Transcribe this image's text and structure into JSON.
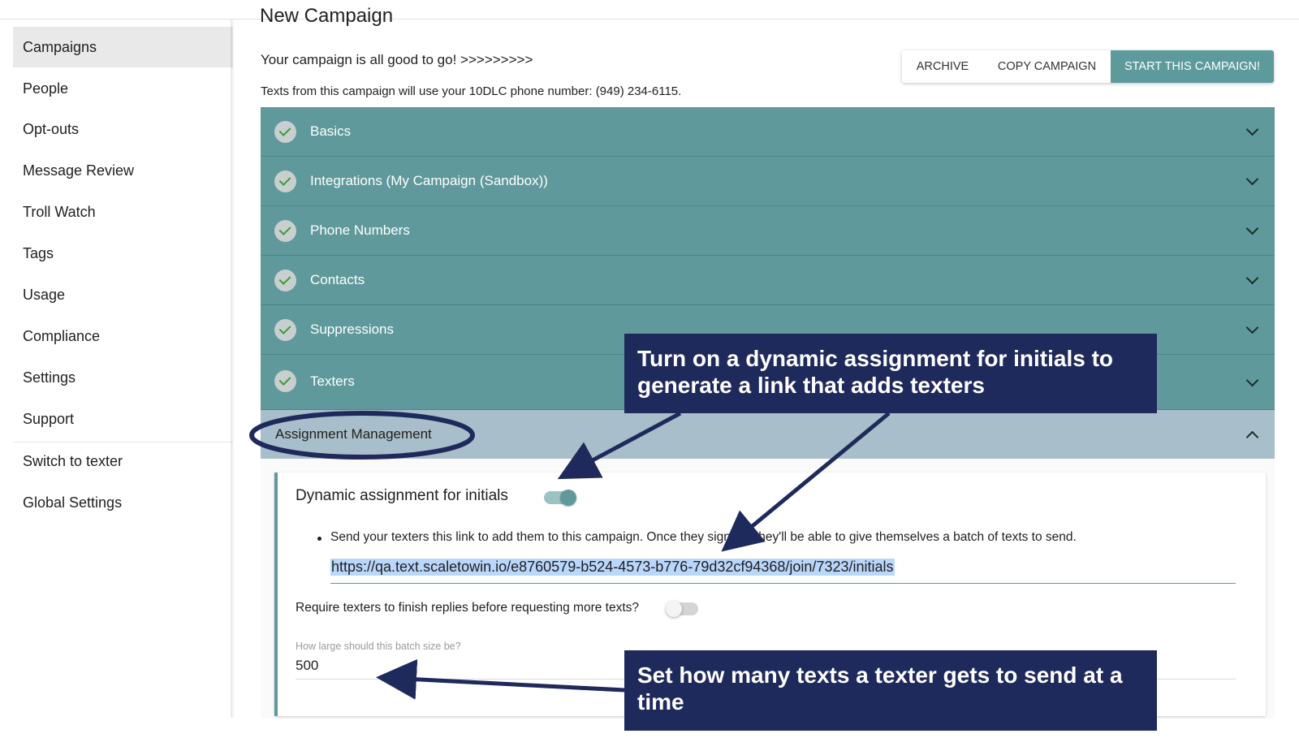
{
  "sidebar": {
    "items": [
      {
        "label": "Campaigns",
        "active": true
      },
      {
        "label": "People"
      },
      {
        "label": "Opt-outs"
      },
      {
        "label": "Message Review"
      },
      {
        "label": "Troll Watch"
      },
      {
        "label": "Tags"
      },
      {
        "label": "Usage"
      },
      {
        "label": "Compliance"
      },
      {
        "label": "Settings"
      },
      {
        "label": "Support"
      },
      {
        "label": "Switch to texter"
      },
      {
        "label": "Global Settings"
      }
    ]
  },
  "header": {
    "title": "New Campaign",
    "status": "Your campaign is all good to go! >>>>>>>>>",
    "phone_notice": "Texts from this campaign will use your 10DLC phone number: (949) 234-6115."
  },
  "toolbar": {
    "archive_label": "ARCHIVE",
    "copy_label": "COPY CAMPAIGN",
    "start_label": "START THIS CAMPAIGN!",
    "accent_color": "#5d9a9c"
  },
  "sections": [
    {
      "label": "Basics",
      "complete": true
    },
    {
      "label": "Integrations (My Campaign (Sandbox))",
      "complete": true
    },
    {
      "label": "Phone Numbers",
      "complete": true
    },
    {
      "label": "Contacts",
      "complete": true
    },
    {
      "label": "Suppressions",
      "complete": true
    },
    {
      "label": "Texters",
      "complete": true
    }
  ],
  "assignment": {
    "section_label": "Assignment Management",
    "expanded": true,
    "dynamic_label": "Dynamic assignment for initials",
    "dynamic_enabled": true,
    "link_instruction": "Send your texters this link to add them to this campaign. Once they sign up, they'll be able to give themselves a batch of texts to send.",
    "link_url": "https://qa.text.scaletowin.io/e8760579-b524-4573-b776-79d32cf94368/join/7323/initials",
    "require_label": "Require texters to finish replies before requesting more texts?",
    "require_enabled": false,
    "batch_caption": "How large should this batch size be?",
    "batch_value": "500"
  },
  "annotations": {
    "top": "Turn on a dynamic assignment for initials to generate a link that adds texters",
    "bottom": "Set how many texts a texter gets to send at a time",
    "color": "#1f2a5c"
  }
}
